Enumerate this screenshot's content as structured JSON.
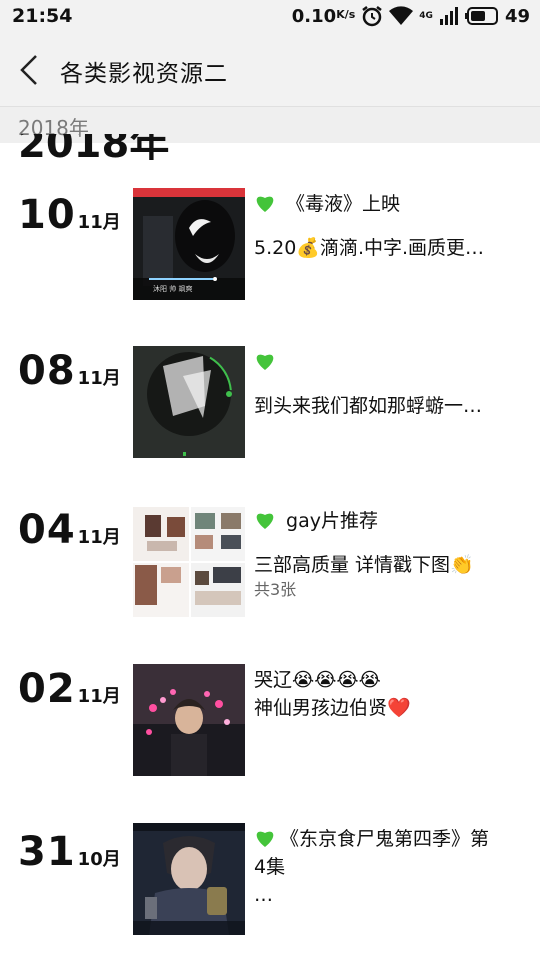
{
  "status_bar": {
    "time": "21:54",
    "speed_value": "0.10",
    "speed_unit": "K/s",
    "network": "4G",
    "battery": "49"
  },
  "header": {
    "title": "各类影视资源二"
  },
  "year_bar": {
    "label": "2018年",
    "big_label": "2018年"
  },
  "colors": {
    "heart_green": "#44c43a",
    "heart_red": "#d8202a"
  },
  "posts": [
    {
      "day": "10",
      "month": "11月",
      "line1": "《毒液》上映",
      "line2": "5.20💰滴滴.中字.画质更…",
      "thumb": "venom-movie-still",
      "thumb_text": "沐阳  帅  飒爽"
    },
    {
      "day": "08",
      "month": "11月",
      "line1": "",
      "line2": "到头来我们都如那蜉蝣一…",
      "thumb": "dark-circular-photo"
    },
    {
      "day": "04",
      "month": "11月",
      "line1": "gay片推荐",
      "line2": "三部高质量 详情戳下图👏",
      "count": "共3张",
      "thumb": "collage-of-screenshots"
    },
    {
      "day": "02",
      "month": "11月",
      "line1": "哭辽😭😭😭😭",
      "line2": "神仙男孩边伯贤❤️",
      "thumb": "singer-on-stage"
    },
    {
      "day": "31",
      "month": "10月",
      "line1": "《东京食尸鬼第四季》第",
      "line1b": "4集",
      "line2": "…",
      "thumb": "anime-screenshot"
    }
  ]
}
